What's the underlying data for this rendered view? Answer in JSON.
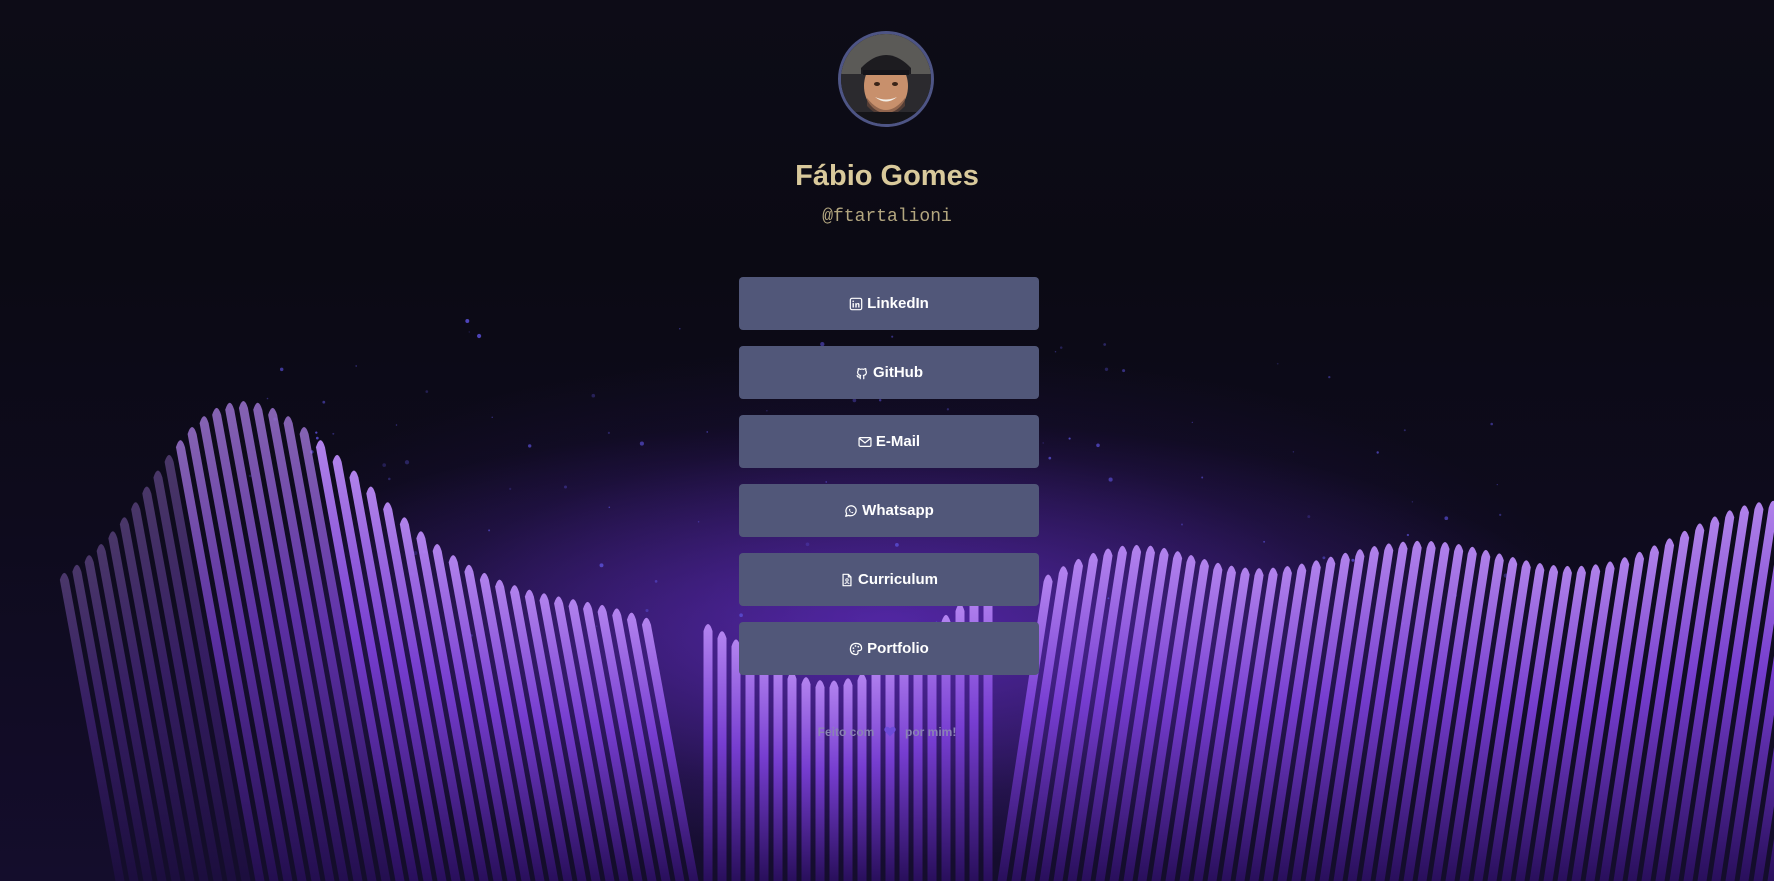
{
  "profile": {
    "name": "Fábio Gomes",
    "handle": "@ftartalioni"
  },
  "links": [
    {
      "label": "LinkedIn",
      "icon": "linkedin-icon"
    },
    {
      "label": "GitHub",
      "icon": "github-icon"
    },
    {
      "label": "E-Mail",
      "icon": "mail-icon"
    },
    {
      "label": "Whatsapp",
      "icon": "whatsapp-icon"
    },
    {
      "label": "Curriculum",
      "icon": "file-icon"
    },
    {
      "label": "Portfolio",
      "icon": "palette-icon"
    }
  ],
  "footer": {
    "before": "Feito com",
    "after": "por mim!",
    "icon": "heart-icon"
  },
  "colors": {
    "background": "#0b0a14",
    "button": "#515779",
    "name": "#d9c99b",
    "accent": "#7b3fe4"
  }
}
